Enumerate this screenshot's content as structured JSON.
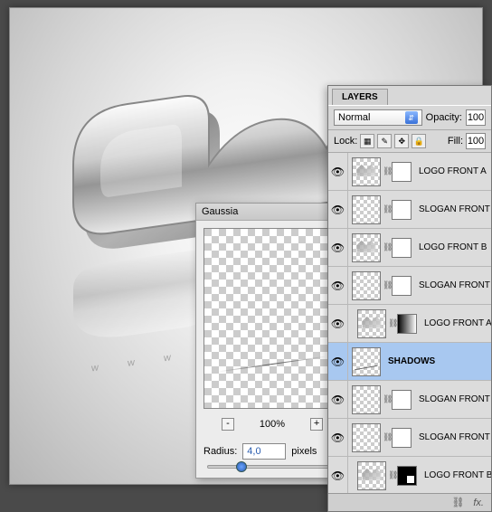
{
  "dialog": {
    "title": "Gaussia",
    "zoom": "100%",
    "radius_label": "Radius:",
    "radius_value": "4,0",
    "radius_unit": "pixels"
  },
  "layers_panel": {
    "tab": "LAYERS",
    "blend_mode": "Normal",
    "opacity_label": "Opacity:",
    "opacity_value": "100",
    "lock_label": "Lock:",
    "fill_label": "Fill:",
    "fill_value": "100",
    "footer_fx": "fx.",
    "layers": [
      {
        "name": "LOGO FRONT A",
        "mask": "plain",
        "logo": true
      },
      {
        "name": "SLOGAN FRONT A",
        "mask": "plain"
      },
      {
        "name": "LOGO FRONT B",
        "mask": "plain",
        "logo": true
      },
      {
        "name": "SLOGAN FRONT B",
        "mask": "plain"
      },
      {
        "name": "LOGO FRONT A_R",
        "mask": "grad",
        "logo": true,
        "indent": true
      },
      {
        "name": "SHADOWS",
        "selected": true,
        "line": true,
        "nomask": true
      },
      {
        "name": "SLOGAN FRONT A_R",
        "mask": "plain"
      },
      {
        "name": "SLOGAN FRONT B_R",
        "mask": "plain"
      },
      {
        "name": "LOGO FRONT B_R",
        "mask": "blk",
        "logo": true,
        "indent": true
      }
    ]
  }
}
